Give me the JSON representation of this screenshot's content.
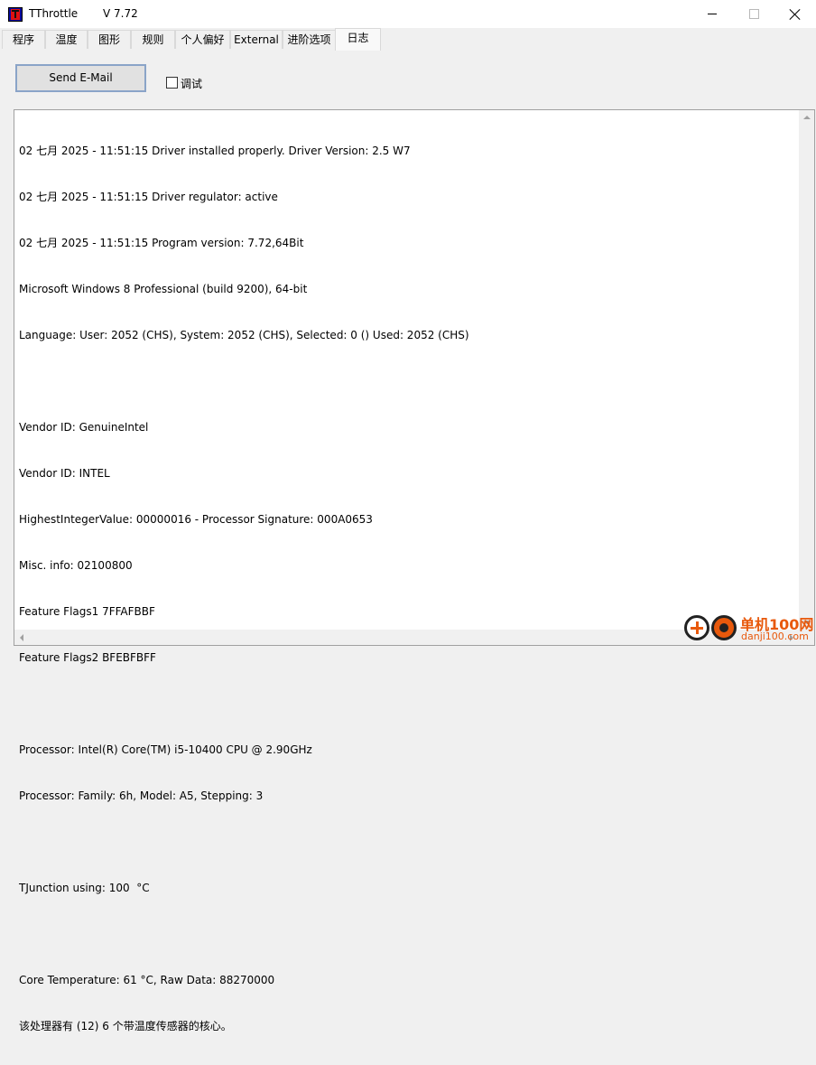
{
  "window": {
    "app_name": "TThrottle",
    "version": "V 7.72"
  },
  "tabs": [
    {
      "label": "程序"
    },
    {
      "label": "温度"
    },
    {
      "label": "图形"
    },
    {
      "label": "规则"
    },
    {
      "label": "个人偏好"
    },
    {
      "label": "External"
    },
    {
      "label": "进阶选项"
    },
    {
      "label": "日志",
      "active": true
    }
  ],
  "log_tab": {
    "send_email_label": "Send E-Mail",
    "debug_label": "调试",
    "debug_checked": false,
    "lines": [
      "02 七月 2025 - 11:51:15 Driver installed properly. Driver Version: 2.5 W7",
      "02 七月 2025 - 11:51:15 Driver regulator: active",
      "02 七月 2025 - 11:51:15 Program version: 7.72,64Bit",
      "Microsoft Windows 8 Professional (build 9200), 64-bit",
      "Language: User: 2052 (CHS), System: 2052 (CHS), Selected: 0 () Used: 2052 (CHS)",
      "",
      "Vendor ID: GenuineIntel",
      "Vendor ID: INTEL",
      "HighestIntegerValue: 00000016 - Processor Signature: 000A0653",
      "Misc. info: 02100800",
      "Feature Flags1 7FFAFBBF",
      "Feature Flags2 BFEBFBFF",
      "",
      "Processor: Intel(R) Core(TM) i5-10400 CPU @ 2.90GHz",
      "Processor: Family: 6h, Model: A5, Stepping: 3",
      "",
      "TJunction using: 100  °C",
      "",
      "Core Temperature: 61 °C, Raw Data: 88270000",
      "该处理器有 (12) 6 个带温度传感器的核心。"
    ]
  },
  "watermark": {
    "name": "单机100网",
    "url": "danji100.com"
  },
  "colors": {
    "accent_border": "#8aa4c8",
    "brand_orange": "#e8590c"
  }
}
